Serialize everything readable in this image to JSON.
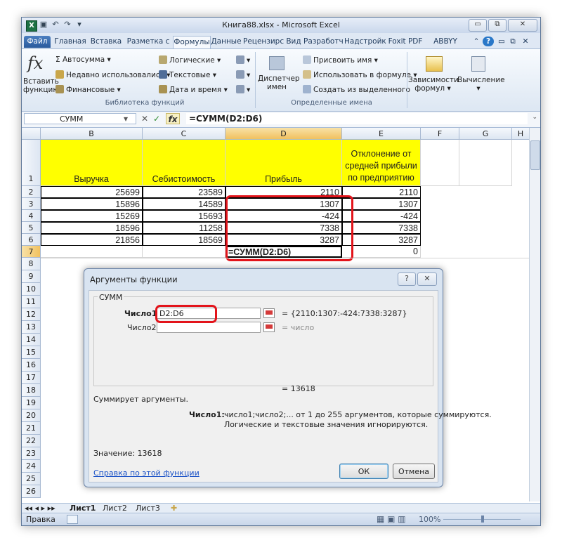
{
  "titlebar": {
    "title": "Книга88.xlsx - Microsoft Excel",
    "app_icon": "X",
    "minimize": "▭",
    "restore": "⧉",
    "close": "✕"
  },
  "tabs": [
    "Файл",
    "Главная",
    "Вставка",
    "Разметка с",
    "Формулы",
    "Данные",
    "Рецензирс",
    "Вид",
    "Разработч",
    "Надстройк",
    "Foxit PDF",
    "ABBYY PDF"
  ],
  "ribbon": {
    "insert_function": [
      "Вставить",
      "функцию"
    ],
    "autosum": "Σ Автосумма ▾",
    "recent": "Недавно использовались ▾",
    "financial": "Финансовые ▾",
    "logical": "Логические ▾",
    "text": "Текстовые ▾",
    "datetime": "Дата и время ▾",
    "group_library": "Библиотека функций",
    "name_manager": [
      "Диспетчер",
      "имен"
    ],
    "define_name": "Присвоить имя ▾",
    "use_in_formula": "Использовать в формуле ▾",
    "create_from_selection": "Создать из выделенного",
    "group_names": "Определенные имена",
    "dependencies": [
      "Зависимости",
      "формул ▾"
    ],
    "calculation": [
      "Вычисление",
      "▾"
    ]
  },
  "formula_bar": {
    "name_box": "СУММ",
    "cancel": "✕",
    "enter": "✓",
    "fx": "fx",
    "formula": "=СУММ(D2:D6)"
  },
  "columns": [
    "B",
    "C",
    "D",
    "E",
    "F",
    "G",
    "H"
  ],
  "rows": [
    "1",
    "2",
    "3",
    "4",
    "5",
    "6",
    "7",
    "8",
    "9",
    "10",
    "11",
    "12",
    "13",
    "14",
    "15",
    "16",
    "17",
    "18",
    "19",
    "20",
    "21",
    "22",
    "23",
    "24",
    "25",
    "26"
  ],
  "table": {
    "headers": {
      "b": "Выручка",
      "c": "Себистоимость",
      "d": "Прибыль",
      "e": [
        "Отклонение от",
        "средней прибыли",
        "по предприятию"
      ]
    },
    "data": [
      [
        "25699",
        "23589",
        "2110",
        "2110"
      ],
      [
        "15896",
        "14589",
        "1307",
        "1307"
      ],
      [
        "15269",
        "15693",
        "-424",
        "-424"
      ],
      [
        "18596",
        "11258",
        "7338",
        "7338"
      ],
      [
        "21856",
        "18569",
        "3287",
        "3287"
      ]
    ],
    "row7_d": "=СУММ(D2:D6)",
    "row7_e": "0"
  },
  "dialog": {
    "title": "Аргументы функции",
    "help_btn": "?",
    "close_btn": "✕",
    "func_name": "СУММ",
    "arg1_label": "Число1",
    "arg1_value": "D2:D6",
    "arg1_result": "= {2110:1307:-424:7338:3287}",
    "arg2_label": "Число2",
    "arg2_result": "= число",
    "total": "= 13618",
    "description": "Суммирует аргументы.",
    "arg_desc_label": "Число1:",
    "arg_desc_line1": "число1;число2;... от 1 до 255 аргументов, которые суммируются.",
    "arg_desc_line2": "Логические и текстовые значения игнорируются.",
    "value_line": "Значение:  13618",
    "help_link": "Справка по этой функции",
    "ok": "ОК",
    "cancel": "Отмена"
  },
  "sheets": [
    "Лист1",
    "Лист2",
    "Лист3"
  ],
  "status": {
    "mode": "Правка",
    "zoom": "100%"
  },
  "colors": {
    "header_fill": "#ffff00",
    "highlight": "#e3141b",
    "file_tab": "#2a5b9c"
  }
}
